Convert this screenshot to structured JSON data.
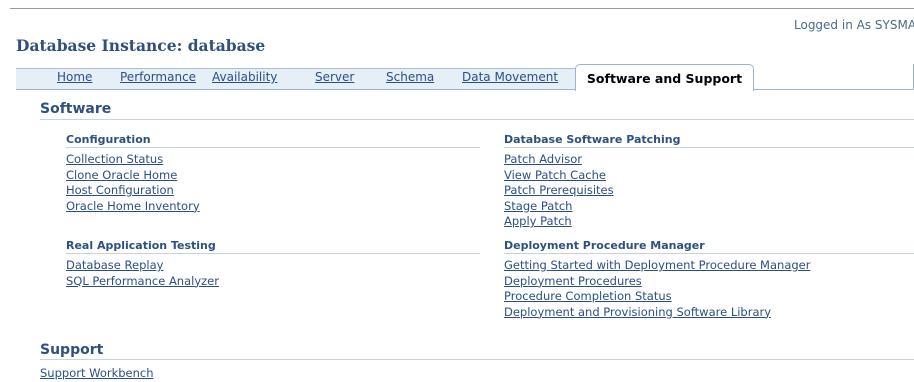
{
  "header": {
    "logged_in": "Logged in As SYSMAN",
    "title": "Database Instance: database"
  },
  "tabs": [
    {
      "label": "Home",
      "active": false
    },
    {
      "label": "Performance",
      "active": false
    },
    {
      "label": "Availability",
      "active": false
    },
    {
      "label": "Server",
      "active": false
    },
    {
      "label": "Schema",
      "active": false
    },
    {
      "label": "Data Movement",
      "active": false
    },
    {
      "label": "Software and Support",
      "active": true
    }
  ],
  "software": {
    "title": "Software",
    "configuration": {
      "title": "Configuration",
      "links": [
        "Collection Status",
        "Clone Oracle Home",
        "Host Configuration",
        "Oracle Home Inventory"
      ]
    },
    "patching": {
      "title": "Database Software Patching",
      "links": [
        "Patch Advisor",
        "View Patch Cache",
        "Patch Prerequisites",
        "Stage Patch",
        "Apply Patch"
      ]
    },
    "rat": {
      "title": "Real Application Testing",
      "links": [
        "Database Replay",
        "SQL Performance Analyzer"
      ]
    },
    "dpm": {
      "title": "Deployment Procedure Manager",
      "links": [
        "Getting Started with Deployment Procedure Manager",
        "Deployment Procedures",
        "Procedure Completion Status",
        "Deployment and Provisioning Software Library"
      ]
    }
  },
  "support": {
    "title": "Support",
    "links": [
      "Support Workbench"
    ]
  },
  "colors": {
    "link": "#2a4f86",
    "heading": "#2f4f7f",
    "tab_bg": "#e6eef6"
  }
}
